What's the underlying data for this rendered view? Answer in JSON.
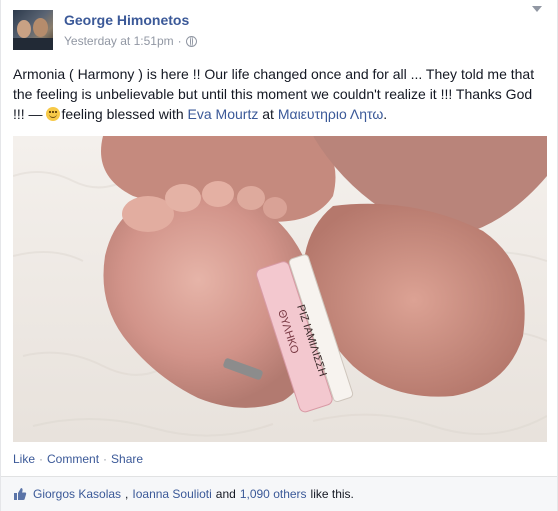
{
  "post": {
    "author": "George Himonetos",
    "timestamp": "Yesterday at 1:51pm",
    "meta_separator": "·",
    "status": {
      "text_main": "Armonia ( Harmony ) is here !! Our life changed once and for all ... They told me that the feeling is unbelievable but until this moment we couldn't realize it !!! Thanks God !!! — ",
      "feeling": "feeling blessed with ",
      "tagged_person": "Eva Mourtz",
      "at": " at ",
      "location": "Μαιευτηριο Λητω",
      "end": "."
    },
    "photo_band_text": [
      "ΡΙΖ ΙΑΜΙΛΙΣΣΗ",
      "ΘΥΛΗΚΟ"
    ]
  },
  "actions": {
    "like": "Like",
    "comment": "Comment",
    "share": "Share",
    "separator": "·"
  },
  "likes": {
    "name1": "Giorgos Kasolas",
    "comma": ",",
    "name2": "Ioanna Soulioti",
    "and": "and",
    "others": "1,090 others",
    "suffix": "like this."
  },
  "colors": {
    "link": "#3b5998",
    "meta": "#9197a3"
  }
}
